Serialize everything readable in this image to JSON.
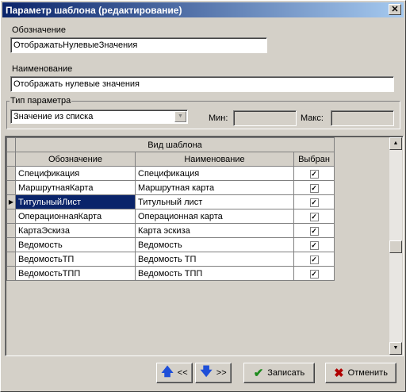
{
  "window": {
    "title": "Параметр шаблона (редактирование)",
    "close": "✕"
  },
  "fields": {
    "designation_label": "Обозначение",
    "designation_value": "ОтображатьНулевыеЗначения",
    "name_label": "Наименование",
    "name_value": "Отображать нулевые значения"
  },
  "param_type": {
    "group_label": "Тип параметра",
    "selected": "Значение из списка",
    "min_label": "Мин:",
    "min_value": "",
    "max_label": "Макс:",
    "max_value": ""
  },
  "grid": {
    "group_header": "Вид шаблона",
    "columns": [
      "Обозначение",
      "Наименование",
      "Выбран"
    ],
    "rows": [
      {
        "code": "Спецификация",
        "name": "Спецификация",
        "checked": true
      },
      {
        "code": "МаршрутнаяКарта",
        "name": "Маршрутная карта",
        "checked": true
      },
      {
        "code": "ТитульныйЛист",
        "name": "Титульный лист",
        "checked": true,
        "selected": true
      },
      {
        "code": "ОперационнаяКарта",
        "name": "Операционная карта",
        "checked": true
      },
      {
        "code": "КартаЭскиза",
        "name": "Карта эскиза",
        "checked": true
      },
      {
        "code": "Ведомость",
        "name": "Ведомость",
        "checked": true
      },
      {
        "code": "ВедомостьТП",
        "name": "Ведомость ТП",
        "checked": true
      },
      {
        "code": "ВедомостьТПП",
        "name": "Ведомость ТПП",
        "checked": true
      }
    ]
  },
  "buttons": {
    "up_label": "<<",
    "down_label": ">>",
    "save_label": "Записать",
    "cancel_label": "Отменить"
  },
  "colors": {
    "accent": "#0a246a",
    "save_icon": "#1e8a1e",
    "cancel_icon": "#b00000",
    "arrow_icon": "#1f4fd8"
  }
}
